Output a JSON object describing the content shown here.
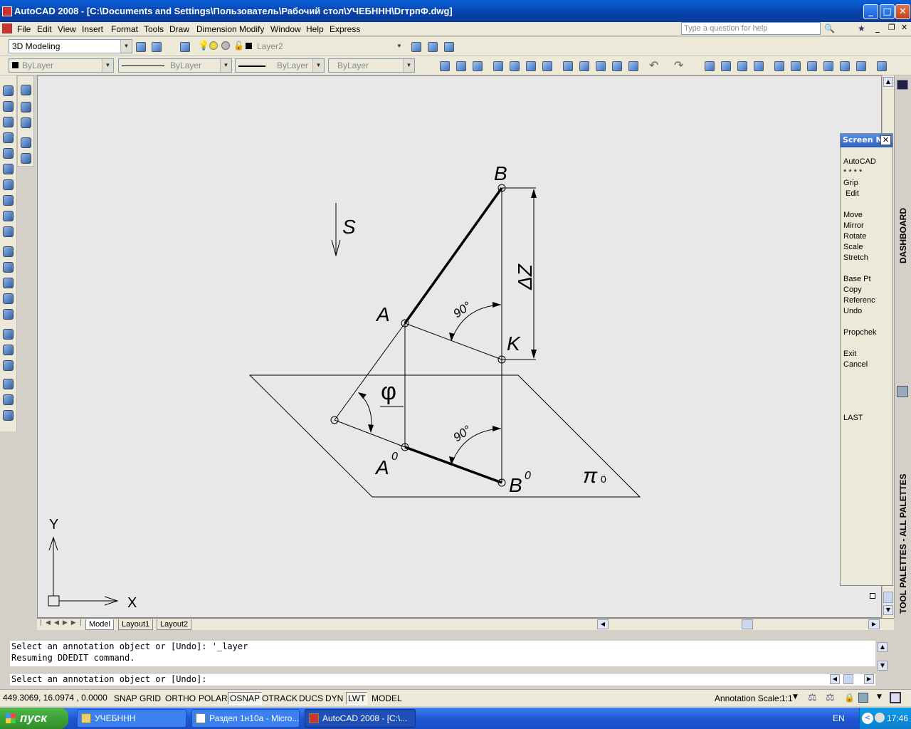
{
  "window": {
    "title": "AutoCAD 2008 - [C:\\Documents and Settings\\Пользователь\\Рабочий стол\\УЧЕБННН\\DгтрпФ.dwg]"
  },
  "menu": {
    "items": [
      "File",
      "Edit",
      "View",
      "Insert",
      "Format",
      "Tools",
      "Draw",
      "Dimension",
      "Modify",
      "Window",
      "Help",
      "Express"
    ],
    "help_placeholder": "Type a question for help"
  },
  "toolbar": {
    "workspace": "3D Modeling",
    "layer": "Layer2",
    "color": "ByLayer",
    "linetype": "ByLayer",
    "lineweight": "ByLayer",
    "plotstyle": "ByLayer"
  },
  "screen_menu": {
    "title": "Screen M",
    "items": [
      "AutoCAD",
      "* * * *",
      "Grip",
      "Edit",
      "Move",
      "Mirror",
      "Rotate",
      "Scale",
      "Stretch",
      "Base Pt",
      "Copy",
      "Referenc",
      "Undo",
      "Propchek",
      "Exit",
      "Cancel",
      "LAST"
    ]
  },
  "side_labels": {
    "dashboard": "DASHBOARD",
    "tool_palettes": "TOOL PALETTES - ALL PALETTES"
  },
  "drawing": {
    "label_B": "B",
    "label_A": "A",
    "label_K": "K",
    "label_S": "S",
    "label_dz": "ΔZ",
    "label_phi": "φ",
    "label_A0": "A",
    "label_A0_sup": "0",
    "label_B0": "B",
    "label_B0_sup": "0",
    "label_pi": "π",
    "label_pi_sub": "0",
    "angle_top": "90°",
    "angle_bottom": "90°",
    "ucs_x": "X",
    "ucs_y": "Y"
  },
  "tabs": [
    "Model",
    "Layout1",
    "Layout2"
  ],
  "command": {
    "history": [
      "Select an annotation object or [Undo]: '_layer",
      "Resuming DDEDIT command."
    ],
    "prompt": "Select an annotation object or [Undo]:"
  },
  "status": {
    "coords": "449.3069, 16.0974 , 0.0000",
    "toggles": [
      {
        "label": "SNAP",
        "on": false
      },
      {
        "label": "GRID",
        "on": false
      },
      {
        "label": "ORTHO",
        "on": false
      },
      {
        "label": "POLAR",
        "on": false
      },
      {
        "label": "OSNAP",
        "on": true
      },
      {
        "label": "OTRACK",
        "on": false
      },
      {
        "label": "DUCS",
        "on": false
      },
      {
        "label": "DYN",
        "on": false
      },
      {
        "label": "LWT",
        "on": true
      },
      {
        "label": "MODEL",
        "on": false
      }
    ],
    "annotation_label": "Annotation Scale:",
    "annotation_value": "1:1"
  },
  "taskbar": {
    "start": "пуск",
    "tasks": [
      "УЧЕБННН",
      "Раздел 1н10а - Micro...",
      "AutoCAD 2008 - [C:\\..."
    ],
    "lang": "EN",
    "time": "17:46"
  }
}
